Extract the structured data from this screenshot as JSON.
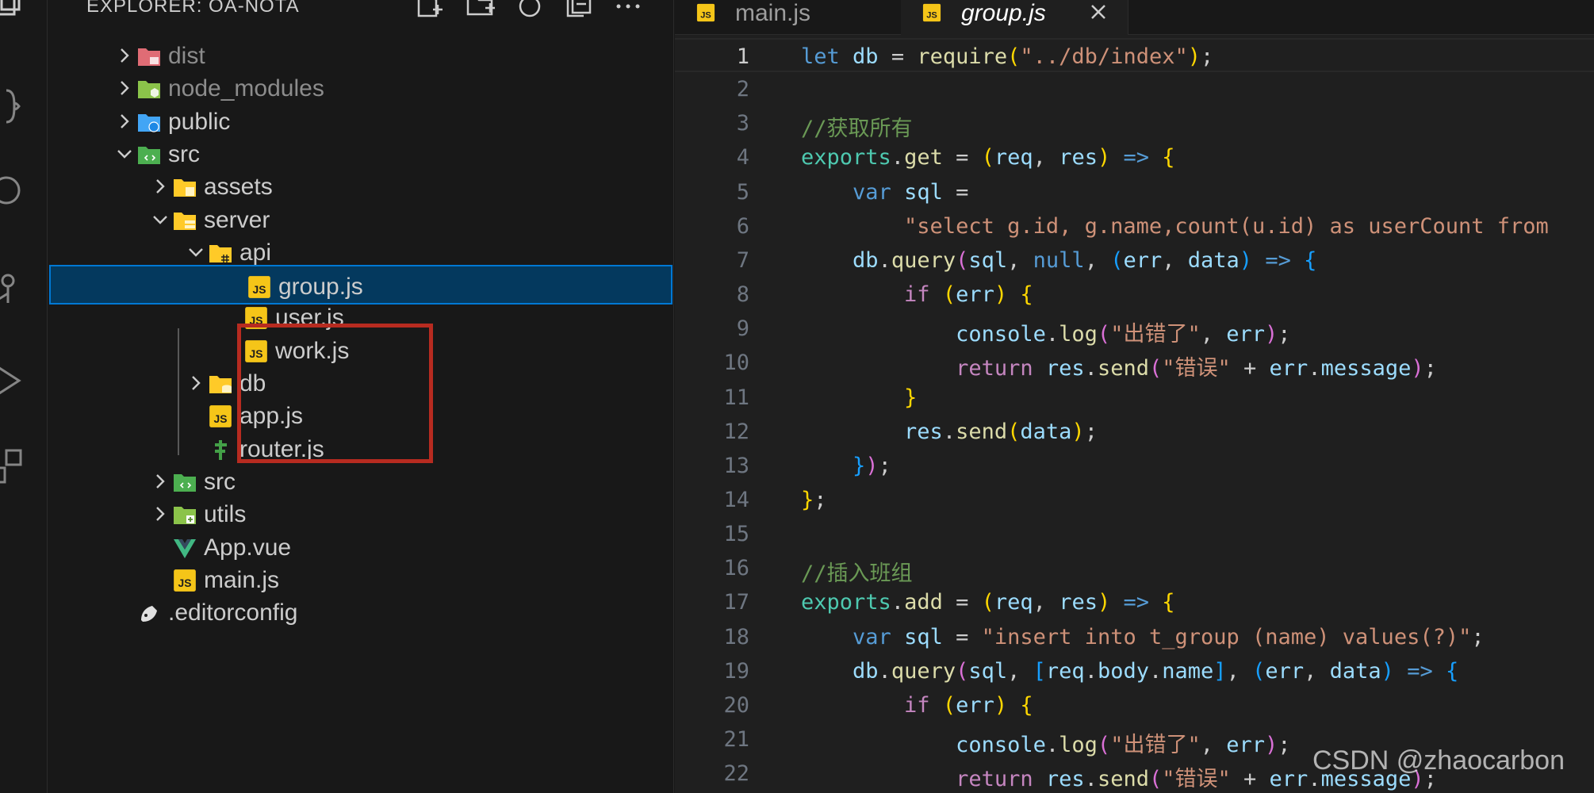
{
  "activity_bar": {
    "icons": [
      "explorer-icon",
      "extensions-icon",
      "search-icon",
      "source-control-icon",
      "run-debug-icon",
      "remote-explorer-icon"
    ]
  },
  "explorer": {
    "title": "EXPLORER: OA-NOTA",
    "header_actions": [
      "new-file-icon",
      "new-folder-icon",
      "refresh-icon",
      "collapse-all-icon",
      "more-actions-icon"
    ],
    "tree": [
      {
        "label": "dist",
        "kind": "folder",
        "expanded": false,
        "icon": "dist-folder-icon",
        "color": "#e06c75",
        "dim": true
      },
      {
        "label": "node_modules",
        "kind": "folder",
        "expanded": false,
        "icon": "node-modules-folder-icon",
        "color": "#8bc34a",
        "dim": true
      },
      {
        "label": "public",
        "kind": "folder",
        "expanded": false,
        "icon": "public-folder-icon",
        "color": "#42a5f5"
      },
      {
        "label": "src",
        "kind": "folder",
        "expanded": true,
        "icon": "src-folder-icon",
        "color": "#4caf50"
      },
      {
        "label": "assets",
        "kind": "folder",
        "expanded": false,
        "icon": "assets-folder-icon",
        "color": "#ffca28"
      },
      {
        "label": "server",
        "kind": "folder",
        "expanded": true,
        "icon": "server-folder-icon",
        "color": "#ffca28"
      },
      {
        "label": "api",
        "kind": "folder",
        "expanded": true,
        "icon": "api-folder-icon",
        "color": "#ffca28"
      },
      {
        "label": "group.js",
        "kind": "file",
        "icon": "js-file-icon",
        "selected": true
      },
      {
        "label": "user.js",
        "kind": "file",
        "icon": "js-file-icon"
      },
      {
        "label": "work.js",
        "kind": "file",
        "icon": "js-file-icon"
      },
      {
        "label": "db",
        "kind": "folder",
        "expanded": false,
        "icon": "db-folder-icon",
        "color": "#ffca28"
      },
      {
        "label": "app.js",
        "kind": "file",
        "icon": "js-file-icon"
      },
      {
        "label": "router.js",
        "kind": "file",
        "icon": "router-file-icon"
      },
      {
        "label": "src",
        "kind": "folder",
        "expanded": false,
        "icon": "src-folder-icon",
        "color": "#4caf50"
      },
      {
        "label": "utils",
        "kind": "folder",
        "expanded": false,
        "icon": "utils-folder-icon",
        "color": "#8bc34a"
      },
      {
        "label": "App.vue",
        "kind": "file",
        "icon": "vue-file-icon"
      },
      {
        "label": "main.js",
        "kind": "file",
        "icon": "js-file-icon"
      },
      {
        "label": ".editorconfig",
        "kind": "file",
        "icon": "editorconfig-file-icon"
      }
    ]
  },
  "tabs": [
    {
      "label": "main.js",
      "active": false,
      "icon": "js-file-icon"
    },
    {
      "label": "group.js",
      "active": true,
      "icon": "js-file-icon"
    }
  ],
  "editor": {
    "active_line": 1,
    "colors": {
      "accent": "#0078d4",
      "selection": "#04395e",
      "highlight_box": "#b72b20"
    },
    "lines": [
      [
        [
          "kw",
          "let"
        ],
        [
          "op",
          " "
        ],
        [
          "var",
          "db"
        ],
        [
          "op",
          " = "
        ],
        [
          "fn",
          "require"
        ],
        [
          "p1",
          "("
        ],
        [
          "str",
          "\"../db/index\""
        ],
        [
          "p1",
          ")"
        ],
        [
          "op",
          ";"
        ]
      ],
      [],
      [
        [
          "cm",
          "//获取所有"
        ]
      ],
      [
        [
          "mod",
          "exports"
        ],
        [
          "op",
          "."
        ],
        [
          "fn",
          "get"
        ],
        [
          "op",
          " = "
        ],
        [
          "p1",
          "("
        ],
        [
          "var",
          "req"
        ],
        [
          "op",
          ", "
        ],
        [
          "var",
          "res"
        ],
        [
          "p1",
          ")"
        ],
        [
          "op",
          " "
        ],
        [
          "kw",
          "=>"
        ],
        [
          "op",
          " "
        ],
        [
          "p1",
          "{"
        ]
      ],
      [
        [
          "op",
          "    "
        ],
        [
          "kw",
          "var"
        ],
        [
          "op",
          " "
        ],
        [
          "var",
          "sql"
        ],
        [
          "op",
          " ="
        ]
      ],
      [
        [
          "op",
          "        "
        ],
        [
          "str",
          "\"select g.id, g.name,count(u.id) as userCount from"
        ]
      ],
      [
        [
          "op",
          "    "
        ],
        [
          "var",
          "db"
        ],
        [
          "op",
          "."
        ],
        [
          "fn",
          "query"
        ],
        [
          "p2",
          "("
        ],
        [
          "var",
          "sql"
        ],
        [
          "op",
          ", "
        ],
        [
          "kw",
          "null"
        ],
        [
          "op",
          ", "
        ],
        [
          "p3",
          "("
        ],
        [
          "var",
          "err"
        ],
        [
          "op",
          ", "
        ],
        [
          "var",
          "data"
        ],
        [
          "p3",
          ")"
        ],
        [
          "op",
          " "
        ],
        [
          "kw",
          "=>"
        ],
        [
          "op",
          " "
        ],
        [
          "p3",
          "{"
        ]
      ],
      [
        [
          "op",
          "        "
        ],
        [
          "ctl",
          "if"
        ],
        [
          "op",
          " "
        ],
        [
          "p1",
          "("
        ],
        [
          "var",
          "err"
        ],
        [
          "p1",
          ")"
        ],
        [
          "op",
          " "
        ],
        [
          "p1",
          "{"
        ]
      ],
      [
        [
          "op",
          "            "
        ],
        [
          "var",
          "console"
        ],
        [
          "op",
          "."
        ],
        [
          "fn",
          "log"
        ],
        [
          "p2",
          "("
        ],
        [
          "str",
          "\"出错了\""
        ],
        [
          "op",
          ", "
        ],
        [
          "var",
          "err"
        ],
        [
          "p2",
          ")"
        ],
        [
          "op",
          ";"
        ]
      ],
      [
        [
          "op",
          "            "
        ],
        [
          "ctl",
          "return"
        ],
        [
          "op",
          " "
        ],
        [
          "var",
          "res"
        ],
        [
          "op",
          "."
        ],
        [
          "fn",
          "send"
        ],
        [
          "p2",
          "("
        ],
        [
          "str",
          "\"错误\""
        ],
        [
          "op",
          " + "
        ],
        [
          "var",
          "err"
        ],
        [
          "op",
          "."
        ],
        [
          "var",
          "message"
        ],
        [
          "p2",
          ")"
        ],
        [
          "op",
          ";"
        ]
      ],
      [
        [
          "op",
          "        "
        ],
        [
          "p1",
          "}"
        ]
      ],
      [
        [
          "op",
          "        "
        ],
        [
          "var",
          "res"
        ],
        [
          "op",
          "."
        ],
        [
          "fn",
          "send"
        ],
        [
          "p1",
          "("
        ],
        [
          "var",
          "data"
        ],
        [
          "p1",
          ")"
        ],
        [
          "op",
          ";"
        ]
      ],
      [
        [
          "op",
          "    "
        ],
        [
          "p3",
          "}"
        ],
        [
          "p2",
          ")"
        ],
        [
          "op",
          ";"
        ]
      ],
      [
        [
          "p1",
          "}"
        ],
        [
          "op",
          ";"
        ]
      ],
      [],
      [
        [
          "cm",
          "//插入班组"
        ]
      ],
      [
        [
          "mod",
          "exports"
        ],
        [
          "op",
          "."
        ],
        [
          "fn",
          "add"
        ],
        [
          "op",
          " = "
        ],
        [
          "p1",
          "("
        ],
        [
          "var",
          "req"
        ],
        [
          "op",
          ", "
        ],
        [
          "var",
          "res"
        ],
        [
          "p1",
          ")"
        ],
        [
          "op",
          " "
        ],
        [
          "kw",
          "=>"
        ],
        [
          "op",
          " "
        ],
        [
          "p1",
          "{"
        ]
      ],
      [
        [
          "op",
          "    "
        ],
        [
          "kw",
          "var"
        ],
        [
          "op",
          " "
        ],
        [
          "var",
          "sql"
        ],
        [
          "op",
          " = "
        ],
        [
          "str",
          "\"insert into t_group (name) values(?)\""
        ],
        [
          "op",
          ";"
        ]
      ],
      [
        [
          "op",
          "    "
        ],
        [
          "var",
          "db"
        ],
        [
          "op",
          "."
        ],
        [
          "fn",
          "query"
        ],
        [
          "p2",
          "("
        ],
        [
          "var",
          "sql"
        ],
        [
          "op",
          ", "
        ],
        [
          "p3",
          "["
        ],
        [
          "var",
          "req"
        ],
        [
          "op",
          "."
        ],
        [
          "var",
          "body"
        ],
        [
          "op",
          "."
        ],
        [
          "var",
          "name"
        ],
        [
          "p3",
          "]"
        ],
        [
          "op",
          ", "
        ],
        [
          "p3",
          "("
        ],
        [
          "var",
          "err"
        ],
        [
          "op",
          ", "
        ],
        [
          "var",
          "data"
        ],
        [
          "p3",
          ")"
        ],
        [
          "op",
          " "
        ],
        [
          "kw",
          "=>"
        ],
        [
          "op",
          " "
        ],
        [
          "p3",
          "{"
        ]
      ],
      [
        [
          "op",
          "        "
        ],
        [
          "ctl",
          "if"
        ],
        [
          "op",
          " "
        ],
        [
          "p1",
          "("
        ],
        [
          "var",
          "err"
        ],
        [
          "p1",
          ")"
        ],
        [
          "op",
          " "
        ],
        [
          "p1",
          "{"
        ]
      ],
      [
        [
          "op",
          "            "
        ],
        [
          "var",
          "console"
        ],
        [
          "op",
          "."
        ],
        [
          "fn",
          "log"
        ],
        [
          "p2",
          "("
        ],
        [
          "str",
          "\"出错了\""
        ],
        [
          "op",
          ", "
        ],
        [
          "var",
          "err"
        ],
        [
          "p2",
          ")"
        ],
        [
          "op",
          ";"
        ]
      ],
      [
        [
          "op",
          "            "
        ],
        [
          "ctl",
          "return"
        ],
        [
          "op",
          " "
        ],
        [
          "var",
          "res"
        ],
        [
          "op",
          "."
        ],
        [
          "fn",
          "send"
        ],
        [
          "p2",
          "("
        ],
        [
          "str",
          "\"错误\""
        ],
        [
          "op",
          " + "
        ],
        [
          "var",
          "err"
        ],
        [
          "op",
          "."
        ],
        [
          "var",
          "message"
        ],
        [
          "p2",
          ")"
        ],
        [
          "op",
          ";"
        ]
      ]
    ]
  },
  "watermark": "CSDN @zhaocarbon"
}
